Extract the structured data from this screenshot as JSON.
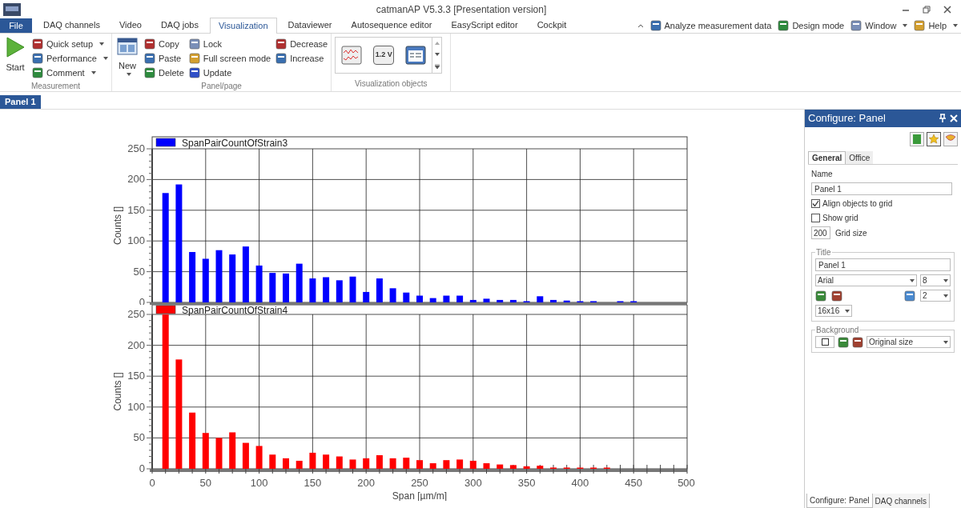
{
  "window": {
    "title": "catmanAP V5.3.3 [Presentation version]"
  },
  "ribbon_tabs": [
    {
      "label": "File",
      "kind": "file",
      "selected": false
    },
    {
      "label": "DAQ channels",
      "kind": "tab",
      "selected": false
    },
    {
      "label": "Video",
      "kind": "tab",
      "selected": false
    },
    {
      "label": "DAQ jobs",
      "kind": "tab",
      "selected": false
    },
    {
      "label": "Visualization",
      "kind": "tab",
      "selected": true
    },
    {
      "label": "Dataviewer",
      "kind": "tab",
      "selected": false
    },
    {
      "label": "Autosequence editor",
      "kind": "tab",
      "selected": false
    },
    {
      "label": "EasyScript editor",
      "kind": "tab",
      "selected": false
    },
    {
      "label": "Cockpit",
      "kind": "tab",
      "selected": false
    }
  ],
  "quick_commands": [
    {
      "label": "Analyze measurement data",
      "dropdown": false
    },
    {
      "label": "Design mode",
      "dropdown": false
    },
    {
      "label": "Window",
      "dropdown": true
    },
    {
      "label": "Help",
      "dropdown": true
    }
  ],
  "ribbon_groups": [
    {
      "label": "Measurement",
      "big": {
        "label": "Start",
        "dropdown": false
      },
      "columns": [
        [
          {
            "label": "Quick setup",
            "dropdown": true
          },
          {
            "label": "Performance",
            "dropdown": true
          },
          {
            "label": "Comment",
            "dropdown": true
          }
        ]
      ]
    },
    {
      "label": "Panel/page",
      "big": {
        "label": "New",
        "dropdown": true
      },
      "columns": [
        [
          {
            "label": "Copy",
            "dropdown": false
          },
          {
            "label": "Paste",
            "dropdown": false
          },
          {
            "label": "Delete",
            "dropdown": false
          }
        ],
        [
          {
            "label": "Lock",
            "dropdown": false
          },
          {
            "label": "Full screen mode",
            "dropdown": false
          },
          {
            "label": "Update",
            "dropdown": false
          }
        ],
        [
          {
            "label": "Decrease",
            "dropdown": false
          },
          {
            "label": "Increase",
            "dropdown": false
          }
        ]
      ]
    },
    {
      "label": "Visualization objects",
      "objects": [
        {
          "kind": "graph"
        },
        {
          "kind": "digital",
          "label": "1.2 V"
        },
        {
          "kind": "table"
        }
      ]
    }
  ],
  "panel_tabs": [
    {
      "label": "Panel 1",
      "selected": true
    }
  ],
  "charts": [
    {
      "chart_data": {
        "type": "bar",
        "ylabel": "Counts []",
        "x": [
          12.5,
          25,
          37.5,
          50,
          62.5,
          75,
          87.5,
          100,
          112.5,
          125,
          137.5,
          150,
          162.5,
          175,
          187.5,
          200,
          212.5,
          225,
          237.5,
          250,
          262.5,
          275,
          287.5,
          300,
          312.5,
          325,
          337.5,
          350,
          362.5,
          375,
          387.5,
          400,
          412.5,
          425,
          437.5,
          450
        ],
        "series": [
          {
            "name": "SpanPairCountOfStrain3",
            "color": "#0000ff",
            "values": [
              178,
              192,
              82,
              71,
              85,
              78,
              91,
              60,
              48,
              47,
              63,
              39,
              41,
              36,
              42,
              17,
              39,
              23,
              16,
              11,
              7,
              11,
              11,
              4,
              6,
              4,
              4,
              2,
              10,
              4,
              3,
              1,
              2,
              null,
              1,
              1
            ]
          }
        ],
        "grid": true,
        "xlim": [
          0,
          500
        ],
        "ylim": [
          0,
          250
        ],
        "yticks": [
          0,
          50,
          100,
          150,
          200,
          250
        ]
      }
    },
    {
      "chart_data": {
        "type": "bar",
        "xlabel": "Span [µm/m]",
        "ylabel": "Counts []",
        "x": [
          12.5,
          25,
          37.5,
          50,
          62.5,
          75,
          87.5,
          100,
          112.5,
          125,
          137.5,
          150,
          162.5,
          175,
          187.5,
          200,
          212.5,
          225,
          237.5,
          250,
          262.5,
          275,
          287.5,
          300,
          312.5,
          325,
          337.5,
          350,
          362.5,
          375,
          387.5,
          400,
          412.5,
          425
        ],
        "series": [
          {
            "name": "SpanPairCountOfStrain4",
            "color": "#ff0000",
            "values": [
              250,
              177,
              91,
              58,
              50,
              59,
              42,
              37,
              23,
              17,
              13,
              26,
              23,
              20,
              15,
              17,
              22,
              17,
              18,
              14,
              9,
              14,
              15,
              13,
              9,
              7,
              6,
              4,
              5,
              2,
              2,
              1,
              1,
              1
            ]
          }
        ],
        "grid": true,
        "xlim": [
          0,
          500
        ],
        "ylim": [
          0,
          250
        ],
        "xticks": [
          0,
          50,
          100,
          150,
          200,
          250,
          300,
          350,
          400,
          450,
          {
            "value": 500,
            "label": "500"
          }
        ],
        "yticks": [
          0,
          50,
          100,
          150,
          200,
          250
        ]
      }
    }
  ],
  "config_panel": {
    "title": "Configure: Panel",
    "tabs": [
      {
        "label": "General",
        "selected": true
      },
      {
        "label": "Office",
        "selected": false
      }
    ],
    "name_label": "Name",
    "name_value": "Panel 1",
    "checkboxes": [
      {
        "label": "Align objects to grid",
        "checked": true
      },
      {
        "label": "Show grid",
        "checked": false
      }
    ],
    "grid_size": {
      "value": "200",
      "label": "Grid size"
    },
    "title_group": {
      "legend": "Title",
      "value": "Panel 1",
      "font": "Arial",
      "size": "8",
      "spacing": "2",
      "icon_size": "16x16"
    },
    "background_group": {
      "legend": "Background",
      "mode": "Original size"
    }
  },
  "bottom_tabs": [
    {
      "label": "Configure: Panel",
      "selected": true
    },
    {
      "label": "DAQ channels",
      "selected": false
    }
  ]
}
